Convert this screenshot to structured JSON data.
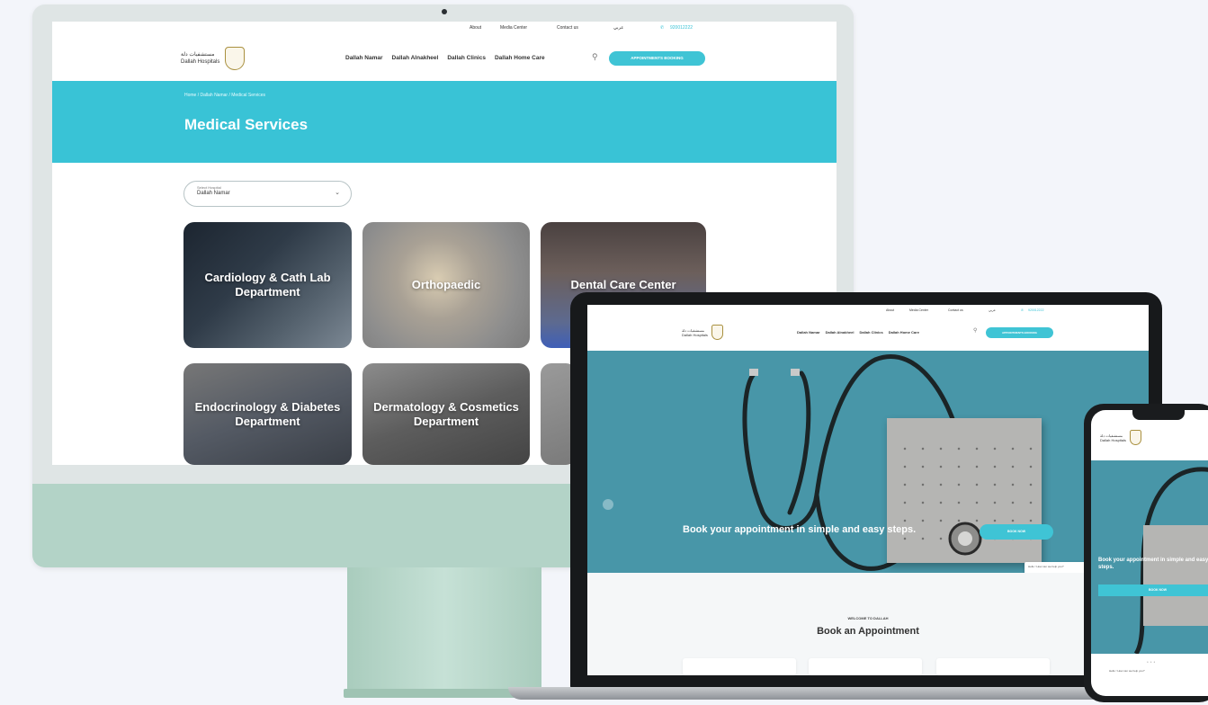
{
  "brand": {
    "name_arabic": "مستشفيات دلة",
    "name_english": "Dallah Hospitals"
  },
  "topbar": {
    "links": [
      "About",
      "Media Center",
      "Contact us",
      "عربي"
    ],
    "phone": "920012222"
  },
  "nav": {
    "items": [
      "Dallah Namar",
      "Dallah Alnakheel",
      "Dallah Clinics",
      "Dallah Home Care"
    ],
    "appointment_button": "APPOINTMENTS BOOKING"
  },
  "desktop_page": {
    "breadcrumb": "Home  /  Dallah Namar  /  Medical Services",
    "title": "Medical Services",
    "hospital_select": {
      "label": "Select Hospital",
      "value": "Dallah Namar"
    },
    "departments": [
      "Cardiology & Cath Lab Department",
      "Orthopaedic",
      "Dental Care Center",
      "Endocrinology & Diabetes Department",
      "Dermatology & Cosmetics Department",
      ""
    ]
  },
  "laptop_page": {
    "hero_text": "Book your appointment in simple and easy steps.",
    "hero_button": "BOOK NOW",
    "toast_text": "Hello ! How can we help you?",
    "welcome": "WELCOME TO DALLAH",
    "section_title": "Book an Appointment"
  },
  "phone_page": {
    "hero_text": "Book your appointment in simple and easy steps.",
    "hero_button": "BOOK NOW",
    "toast_text": "Hello ! How can we help you?"
  },
  "colors": {
    "accent": "#39c3d6",
    "hero": "#4896a8",
    "imac_chin": "#b3d3c7"
  },
  "icons": [
    "search-icon",
    "phone-icon",
    "chevron-down-icon",
    "arrow-left-icon",
    "shield-logo-icon"
  ]
}
